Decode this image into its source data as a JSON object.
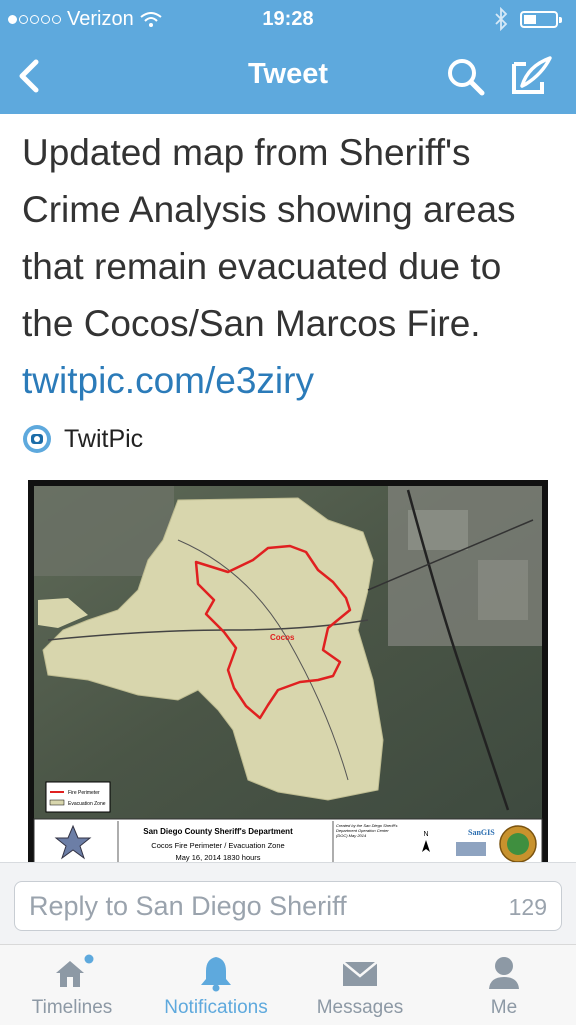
{
  "status": {
    "carrier": "Verizon",
    "time": "19:28"
  },
  "nav": {
    "title": "Tweet"
  },
  "tweet": {
    "text": "Updated map from Sheriff's Crime Analysis showing areas that remain evacuated due to the Cocos/San Marcos Fire. ",
    "link": "twitpic.com/e3ziry",
    "source": "TwitPic"
  },
  "map": {
    "fire_label": "Cocos",
    "title_line1": "San Diego County Sheriff's Department",
    "title_line2": "Cocos Fire Perimeter / Evacuation Zone",
    "title_line3": "May 16, 2014 1830 hours",
    "credit": "Created by the San Diego Sheriff's Department Operation Center (DOC) May 2014",
    "legend_perimeter": "Fire Perimeter",
    "legend_evac": "Evacuation Zone",
    "north": "N",
    "sangis": "SanGIS"
  },
  "reply": {
    "placeholder": "Reply to San Diego Sheriff",
    "count": "129"
  },
  "tabs": [
    {
      "label": "Timelines",
      "icon": "home-icon"
    },
    {
      "label": "Notifications",
      "icon": "bell-icon"
    },
    {
      "label": "Messages",
      "icon": "envelope-icon"
    },
    {
      "label": "Me",
      "icon": "person-icon"
    }
  ],
  "colors": {
    "accent": "#5ea9dd",
    "link": "#2b7bb9",
    "fire": "#e02020"
  }
}
